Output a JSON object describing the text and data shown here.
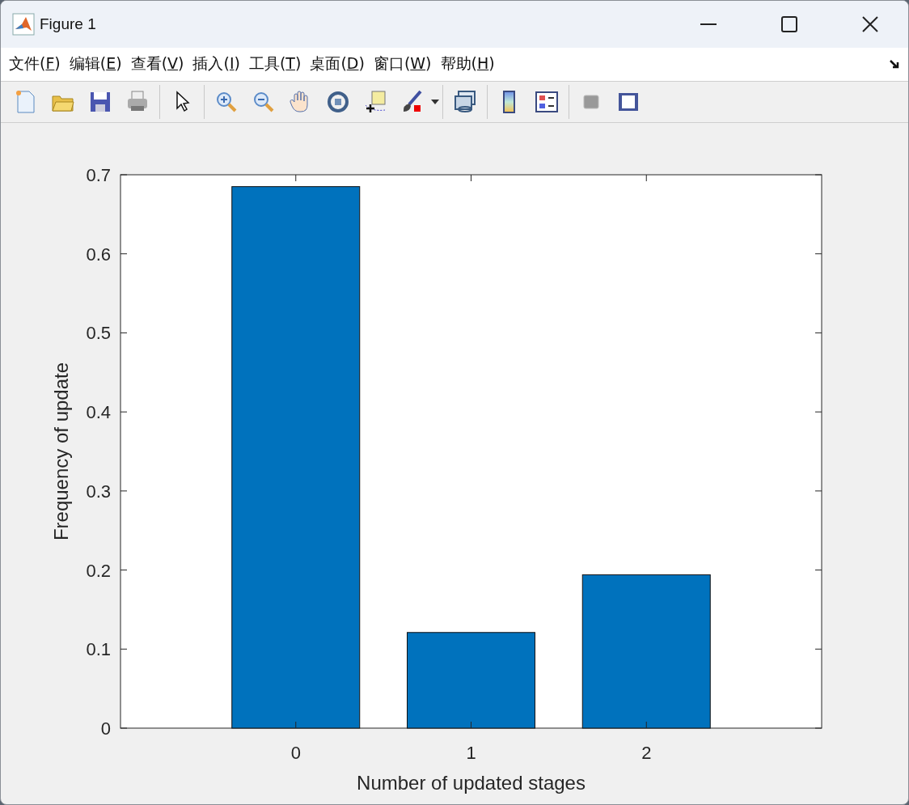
{
  "window": {
    "title": "Figure 1"
  },
  "menu": [
    {
      "label": "文件(",
      "accel": "F",
      "end": ")"
    },
    {
      "label": "编辑(",
      "accel": "E",
      "end": ")"
    },
    {
      "label": "查看(",
      "accel": "V",
      "end": ")"
    },
    {
      "label": "插入(",
      "accel": "I",
      "end": ")"
    },
    {
      "label": "工具(",
      "accel": "T",
      "end": ")"
    },
    {
      "label": "桌面(",
      "accel": "D",
      "end": ")"
    },
    {
      "label": "窗口(",
      "accel": "W",
      "end": ")"
    },
    {
      "label": "帮助(",
      "accel": "H",
      "end": ")"
    }
  ],
  "chart_data": {
    "type": "bar",
    "xlabel": "Number of updated stages",
    "ylabel": "Frequency of update",
    "categories": [
      "0",
      "1",
      "2"
    ],
    "series": [
      {
        "color": "#0072bd",
        "values": [
          0.685,
          0.121,
          0.194
        ]
      }
    ],
    "ylim": [
      0,
      0.7
    ],
    "yticks": [
      0,
      0.1,
      0.2,
      0.3,
      0.4,
      0.5,
      0.6,
      0.7
    ]
  }
}
